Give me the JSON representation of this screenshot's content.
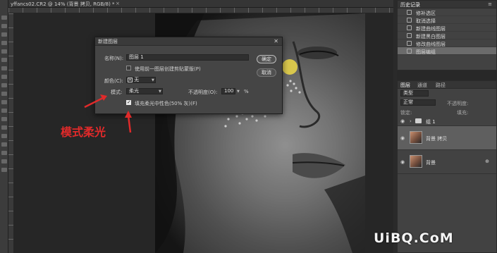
{
  "document": {
    "tab_title": "yffancs02.CR2 @ 14% (背景 拷贝, RGB/8) *",
    "close_glyph": "×"
  },
  "dialog": {
    "title": "新建图层",
    "close_glyph": "✕",
    "name_label": "名称(N):",
    "name_value": "图层 1",
    "clip_label": "使用前一图层创建剪贴蒙版(P)",
    "clip_checked": false,
    "color_label": "颜色(C):",
    "color_value": "无",
    "color_swatch": "✕",
    "mode_label": "模式:",
    "mode_value": "柔光",
    "opacity_label": "不透明度(O):",
    "opacity_value": "100",
    "opacity_unit": "%",
    "fill_label": "填充柔光中性色(50% 灰)(F)",
    "fill_checked": true,
    "ok_label": "确定",
    "cancel_label": "取消"
  },
  "annotation": {
    "text": "模式柔光",
    "color": "#e02a2a"
  },
  "history_panel": {
    "title": "历史记录",
    "items": [
      {
        "label": "修补选区",
        "icon": "history-step-icon"
      },
      {
        "label": "取消选择",
        "icon": "history-step-icon"
      },
      {
        "label": "新建曲线图层",
        "icon": "history-step-icon"
      },
      {
        "label": "新建黑白图层",
        "icon": "history-step-icon"
      },
      {
        "label": "修改曲线图层",
        "icon": "history-step-icon"
      },
      {
        "label": "图层编组",
        "icon": "history-step-icon",
        "selected": true
      }
    ]
  },
  "layers_panel": {
    "tabs": [
      "图层",
      "通道",
      "路径"
    ],
    "kind_placeholder": "类型",
    "blend_mode": "正常",
    "opacity_label": "不透明度:",
    "lock_label": "锁定:",
    "fill_label": "填充:",
    "layers": [
      {
        "name": "组 1",
        "type": "group"
      },
      {
        "name": "背景 拷贝",
        "type": "pixel",
        "selected": true
      },
      {
        "name": "背景",
        "type": "pixel",
        "locked": true
      }
    ]
  },
  "watermark": {
    "text": "UiBQ.CoM"
  },
  "colors": {
    "accent_yellow": "#e6d24a",
    "arrow_red": "#e02a2a"
  }
}
